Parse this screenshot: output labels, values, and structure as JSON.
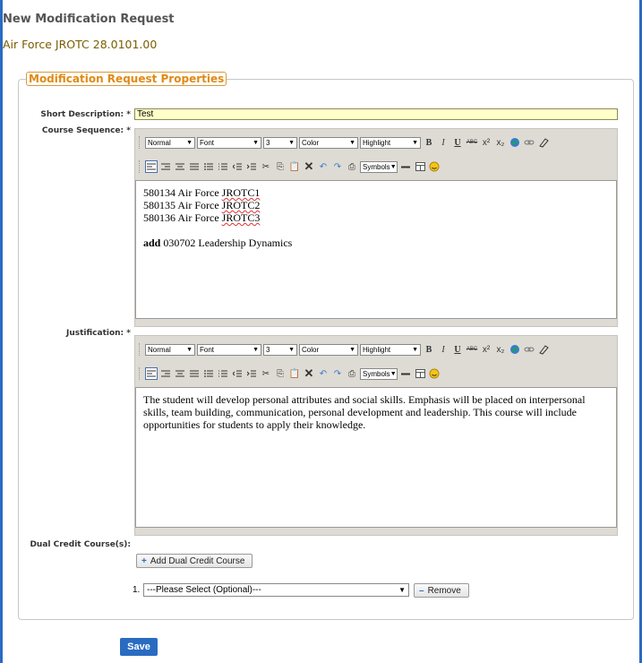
{
  "page": {
    "title": "New Modification Request",
    "subtitle": "Air Force JROTC 28.0101.00",
    "legend": "Modification Request Properties"
  },
  "fields": {
    "short_description_label": "Short Description:",
    "course_sequence_label": "Course Sequence:",
    "justification_label": "Justification:",
    "dual_credit_label": "Dual Credit Course(s):",
    "required_mark": "*",
    "short_description_value": "Test"
  },
  "toolbar": {
    "format": "Normal",
    "font": "Font",
    "size": "3",
    "color": "Color",
    "highlight": "Highlight",
    "symbols": "Symbols",
    "bold": "B",
    "italic": "I",
    "underline": "U",
    "strike": "ABC"
  },
  "course_sequence": {
    "lines": [
      {
        "prefix": "580134 Air Force ",
        "word": "JROTC1"
      },
      {
        "prefix": "580135 Air Force ",
        "word": "JROTC2"
      },
      {
        "prefix": "580136 Air Force ",
        "word": "JROTC3"
      }
    ],
    "add_bold": "add",
    "add_rest": " 030702 Leadership Dynamics"
  },
  "justification": {
    "text": "The student will develop personal attributes and social skills. Emphasis will be placed on interpersonal skills, team building, communication, personal development and leadership. This course will include opportunities for students to apply their knowledge."
  },
  "dual_credit": {
    "add_button": "Add Dual Credit Course",
    "row_number": "1.",
    "select_value": "---Please Select (Optional)---",
    "remove_button": "Remove"
  },
  "actions": {
    "save": "Save"
  },
  "colors": {
    "accent": "#2a6bc2",
    "legend": "#e08a16",
    "input_bg": "#ffffc8"
  }
}
